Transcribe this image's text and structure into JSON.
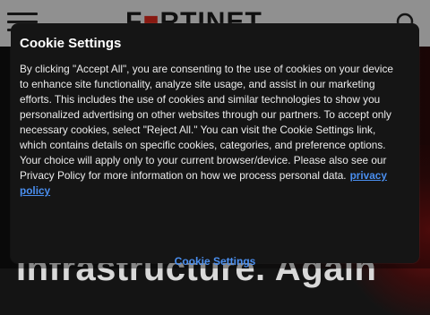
{
  "site": {
    "logo_text": "F",
    "logo_mark": "■",
    "logo_rest": "RTINET",
    "hero_headline": "Infrastructure. Again",
    "icons": {
      "menu": "hamburger-menu-icon",
      "search": "search-icon"
    }
  },
  "cookie_dialog": {
    "title": "Cookie Settings",
    "body": "By clicking \"Accept All\", you are consenting to the use of cookies on your device to enhance site functionality, analyze site usage, and assist in our marketing efforts. This includes the use of cookies and similar technologies to show you personalized advertising on other websites through our partners. To accept only necessary cookies, select \"Reject All.\" You can visit the Cookie Settings link, which contains details on specific cookies, categories, and preference options. Your choice will apply only to your current browser/device. Please also see our Privacy Policy for more information on how we process personal data.",
    "privacy_link_label": "privacy policy",
    "settings_link_label": "Cookie Settings"
  },
  "colors": {
    "brand_red": "#da291c",
    "link_blue": "#4a8ff0",
    "dialog_bg": "#151515"
  }
}
